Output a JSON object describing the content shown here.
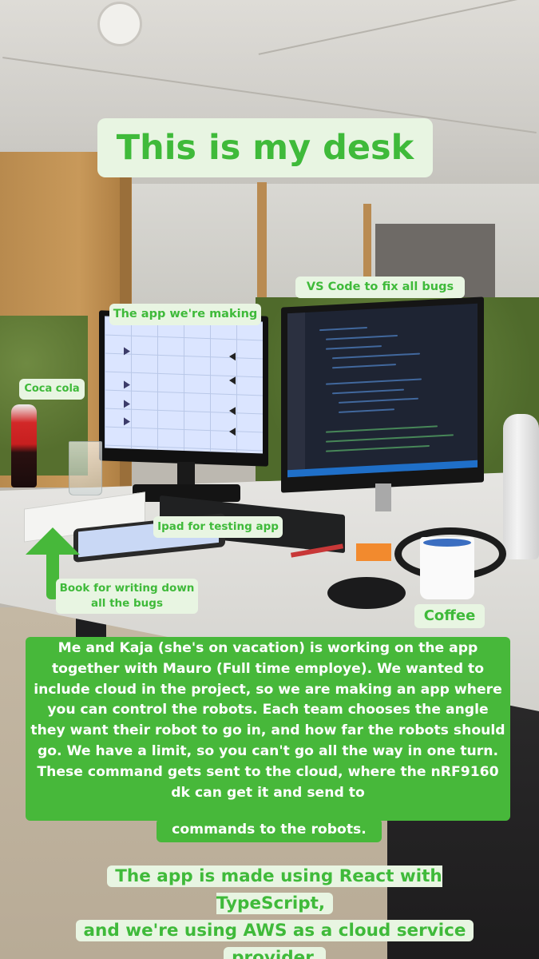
{
  "title": "This is my desk",
  "labels": {
    "app": "The app we're making",
    "vscode": "VS Code to fix all bugs",
    "coca_cola": "Coca cola",
    "ipad": "Ipad for testing app",
    "book": "Book for writing down all the bugs",
    "coffee": "Coffee"
  },
  "description": {
    "main": "Me and Kaja (she's on vacation) is working on the app together with Mauro (Full time employe). We wanted to include cloud in the project, so we are making an app where you can control the robots. Each team chooses the angle they want their robot to go in, and how far the robots should go. We have a limit, so you can't go all the way in one turn. These command gets sent to the cloud, where the nRF9160 dk can get it and send to",
    "tail": "commands to the robots."
  },
  "footer": {
    "line1": "The app is made using React with TypeScript,",
    "line2": "and we're using AWS as a cloud service",
    "line3": "provider."
  },
  "colors": {
    "accent_green": "#47b83a",
    "label_pale_background": "#e8f5e2",
    "label_text_green": "#3fba3a"
  },
  "icons": [
    "up-arrow-icon"
  ]
}
